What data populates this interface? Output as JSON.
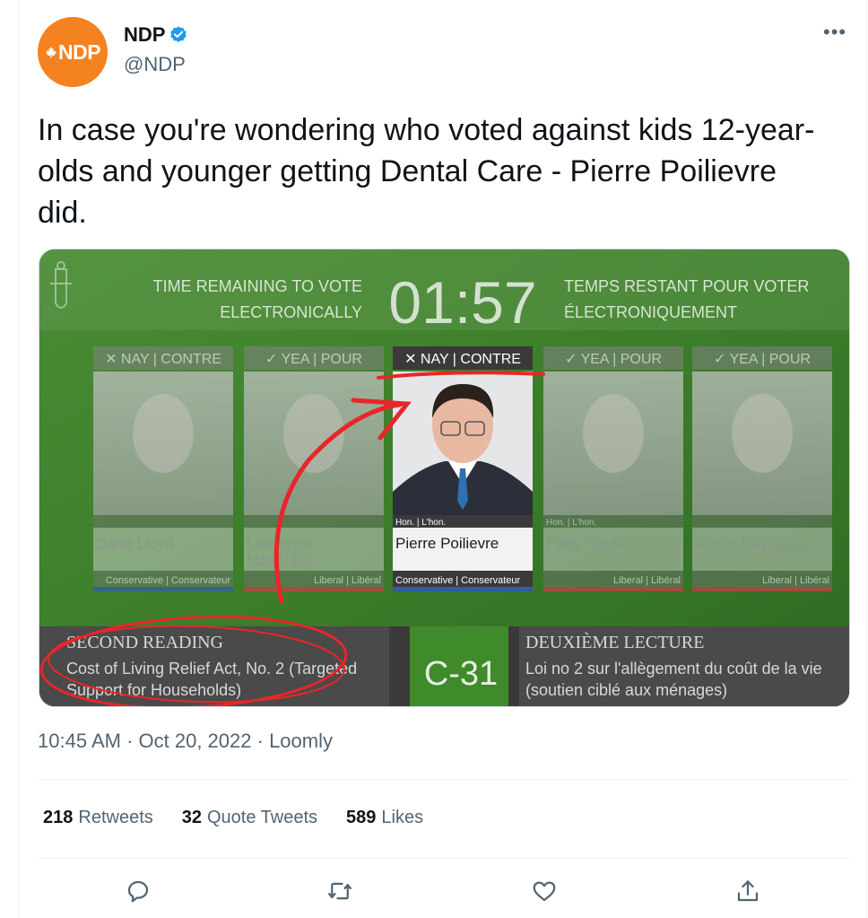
{
  "account": {
    "display_name": "NDP",
    "handle": "@NDP",
    "avatar_text": "NDP",
    "avatar_color": "#f58220",
    "verified": true
  },
  "tweet": {
    "text": "In case you're wondering who voted against kids 12-year-olds and younger getting Dental Care - Pierre Poilievre did.",
    "time": "10:45 AM",
    "date": "Oct 20, 2022",
    "source": "Loomly",
    "separator": " · "
  },
  "media": {
    "timer_label_en_1": "TIME REMAINING TO VOTE",
    "timer_label_en_2": "ELECTRONICALLY",
    "timer": "01:57",
    "timer_label_fr_1": "TEMPS RESTANT POUR VOTER",
    "timer_label_fr_2": "ÉLECTRONIQUEMENT",
    "members": [
      {
        "vote": "✕ NAY | CONTRE",
        "honorific": "",
        "name": "Dane Lloyd",
        "name2": "",
        "party": "Conservative | Conservateur",
        "party_color": "#2f5da8",
        "highlight": false
      },
      {
        "vote": "✓ YEA | POUR",
        "honorific": "",
        "name": "Lawrence",
        "name2": "MacAulay",
        "party": "Liberal | Libéral",
        "party_color": "#d3394a",
        "highlight": false
      },
      {
        "vote": "✕ NAY | CONTRE",
        "honorific": "Hon. | L'hon.",
        "name": "Pierre Poilievre",
        "name2": "",
        "party": "Conservative | Conservateur",
        "party_color": "#2f5da8",
        "highlight": true
      },
      {
        "vote": "✓ YEA | POUR",
        "honorific": "Hon. | L'hon.",
        "name": "Patty Hajdu",
        "name2": "",
        "party": "Liberal | Libéral",
        "party_color": "#d3394a",
        "highlight": false
      },
      {
        "vote": "✓ YEA | POUR",
        "honorific": "",
        "name": "Arielle Kayabaga",
        "name2": "",
        "party": "Liberal | Libéral",
        "party_color": "#d3394a",
        "highlight": false
      }
    ],
    "reading_en": "SECOND READING",
    "bill_en_1": "Cost of Living Relief Act, No. 2 (Targeted",
    "bill_en_2": "Support for Households)",
    "bill_number": "C-31",
    "reading_fr": "DEUXIÈME LECTURE",
    "bill_fr_1": "Loi no 2 sur l'allègement du coût de la vie",
    "bill_fr_2": "(soutien ciblé aux ménages)",
    "annotation_color": "#e8262a"
  },
  "stats": {
    "retweets_count": "218",
    "retweets_label": "Retweets",
    "quotes_count": "32",
    "quotes_label": "Quote Tweets",
    "likes_count": "589",
    "likes_label": "Likes"
  },
  "actions": {
    "reply_icon": "reply-icon",
    "retweet_icon": "retweet-icon",
    "like_icon": "heart-icon",
    "share_icon": "share-icon"
  }
}
